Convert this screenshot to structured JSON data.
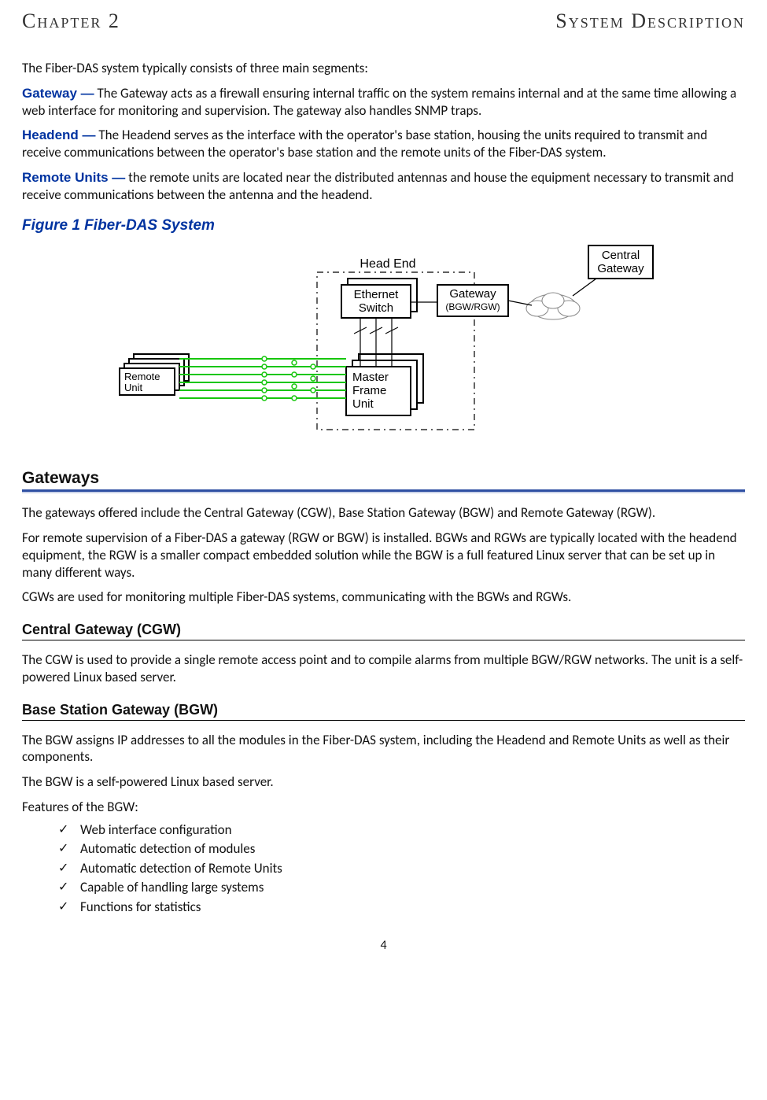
{
  "running_header": {
    "left": "Chapter 2",
    "right": "System Description"
  },
  "intro": "The Fiber-DAS system typically consists of three main segments:",
  "segments": {
    "gateway": {
      "label": "Gateway —",
      "text": " The Gateway acts as a firewall ensuring internal traffic on the system remains internal and at the same time allowing a web interface for monitoring and supervision. The gateway also handles SNMP traps."
    },
    "headend": {
      "label": "Headend —",
      "text": " The Headend serves as the interface with the operator's base station, housing the units required to transmit and receive communications between the operator's base station and the remote units of the Fiber-DAS system."
    },
    "remote": {
      "label": "Remote Units —",
      "text": " the remote units are located near the distributed antennas and house the equipment necessary to transmit and receive communications between the antenna and the headend."
    }
  },
  "figure": {
    "caption": "Figure 1    Fiber-DAS System",
    "labels": {
      "head_end": "Head End",
      "ethernet_switch_1": "Ethernet",
      "ethernet_switch_2": "Switch",
      "gateway_1": "Gateway",
      "gateway_2": "(BGW/RGW)",
      "central_1": "Central",
      "central_2": "Gateway",
      "mfu_1": "Master",
      "mfu_2": "Frame",
      "mfu_3": "Unit",
      "remote_1": "Remote",
      "remote_2": "Unit"
    }
  },
  "gateways": {
    "heading": "Gateways",
    "para1": "The gateways offered include the Central Gateway (CGW), Base Station Gateway (BGW) and Remote Gateway (RGW).",
    "para2": "For remote supervision of a Fiber-DAS a gateway (RGW or BGW) is installed. BGWs and RGWs are typically located with the headend equipment, the RGW is a smaller compact embedded solution while the BGW is a full featured Linux server that can be set up in many different ways.",
    "para3": "CGWs are used for monitoring multiple Fiber-DAS systems, communicating with the BGWs and RGWs."
  },
  "cgw": {
    "heading": "Central Gateway (CGW)",
    "para": "The CGW is used to provide a single remote access point and to compile alarms from multiple BGW/RGW networks. The unit is a self-powered Linux based server."
  },
  "bgw": {
    "heading": "Base Station Gateway (BGW)",
    "para1": "The BGW assigns IP addresses to all the modules in the Fiber-DAS system, including the Headend and Remote Units as well as their components.",
    "para2": "The BGW is a self-powered Linux based server.",
    "features_intro": "Features of the BGW:",
    "features": [
      "Web interface configuration",
      "Automatic detection of modules",
      "Automatic detection of Remote Units",
      "Capable of handling large systems",
      "Functions for statistics"
    ]
  },
  "page_number": "4"
}
